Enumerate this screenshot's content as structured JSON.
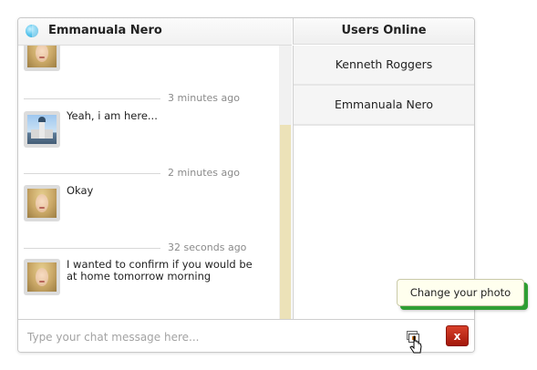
{
  "chat": {
    "title": "Emmanuala Nero",
    "status_icon": "online-globe-icon"
  },
  "users_online": {
    "title": "Users Online",
    "users": [
      {
        "name": "Kenneth Roggers"
      },
      {
        "name": "Emmanuala Nero"
      }
    ]
  },
  "messages": [
    {
      "time": "3 minutes ago",
      "text": "Yeah, i am here...",
      "avatar": "city-avatar"
    },
    {
      "time": "2 minutes ago",
      "text": "Okay",
      "avatar": "woman-avatar"
    },
    {
      "time": "32 seconds ago",
      "text": "I wanted to confirm if you would be at home tomorrow morning",
      "avatar": "woman-avatar"
    }
  ],
  "input": {
    "placeholder": "Type your chat message here..."
  },
  "buttons": {
    "close_label": "x",
    "photo_icon": "change-photo-icon"
  },
  "tooltip": {
    "text": "Change your photo"
  },
  "colors": {
    "close_button": "#b72a17",
    "tooltip_shadow": "#2e9e33",
    "scroll_thumb": "#ece2b8"
  }
}
